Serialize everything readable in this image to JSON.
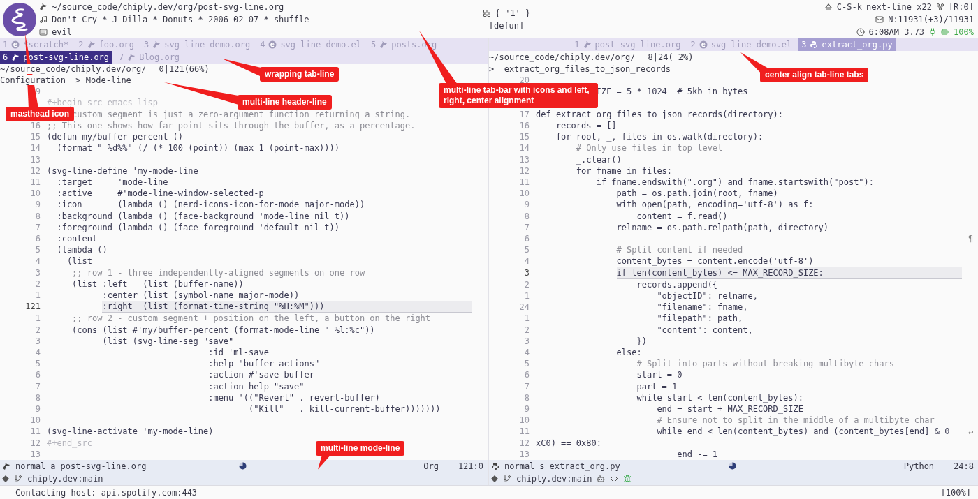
{
  "masthead": {
    "left": [
      {
        "kind": "file",
        "text": "~/source_code/chiply.dev/org/post-svg-line.org"
      },
      {
        "kind": "music",
        "text": "Don't Cry * J Dilla * Donuts * 2006-02-07 * shuffle"
      },
      {
        "kind": "keyboard",
        "text": "evil"
      }
    ],
    "center": [
      {
        "kind": "grid",
        "text": "{ '1' }"
      },
      {
        "kind": "plain",
        "text": "[defun]"
      }
    ],
    "right": [
      [
        {
          "kind": "eject",
          "text": "C-S-k"
        },
        {
          "kind": "plain",
          "text": "next-line x22"
        },
        {
          "kind": "fork",
          "text": "[R:0]"
        }
      ],
      [
        {
          "kind": "mail",
          "text": "N:11931(+3)/11931"
        }
      ],
      [
        {
          "kind": "clock",
          "text": "6:08AM 3.73"
        },
        {
          "kind": "battery",
          "text": "100%"
        }
      ]
    ]
  },
  "panes": [
    {
      "active": true,
      "kind": "wrapping",
      "tab_rows": [
        [
          {
            "number": "1",
            "kind": "elisp",
            "label": "*scratch*",
            "selected": false
          },
          {
            "number": "2",
            "kind": "org",
            "label": "foo.org",
            "selected": false
          },
          {
            "number": "3",
            "kind": "org",
            "label": "svg-line-demo.org",
            "selected": false
          },
          {
            "number": "4",
            "kind": "elisp",
            "label": "svg-line-demo.el",
            "selected": false
          },
          {
            "number": "5",
            "kind": "org",
            "label": "posts.org",
            "selected": false
          }
        ],
        [
          {
            "number": "6",
            "kind": "org",
            "label": "post-svg-line.org",
            "selected": true
          },
          {
            "number": "7",
            "kind": "org",
            "label": "Blog.org",
            "selected": false
          }
        ]
      ],
      "header": [
        {
          "path": "~/source_code/chiply.dev/org/",
          "position": "0|121(66%)"
        },
        {
          "breadcrumb": "Configuration  > Mode-line"
        }
      ],
      "lines": [
        {
          "n": "9"
        },
        {
          "text": "#+begin_src emacs-lisp",
          "kind": "meta"
        },
        {
          "text": "     custom segment is just a zero-argument function returning a string.",
          "kind": "comment"
        },
        {
          "n": "16",
          "text": ";; This one shows how far point sits through the buffer, as a percentage.",
          "kind": "comment"
        },
        {
          "n": "15",
          "text": "(defun my/buffer-percent ()",
          "kind": "code"
        },
        {
          "n": "14",
          "text": "  (format \" %d%%\" (/ (* 100 (point)) (max 1 (point-max))))",
          "kind": "code"
        },
        {
          "n": "13"
        },
        {
          "n": "12",
          "text": "(svg-line-define 'my-mode-line",
          "kind": "code"
        },
        {
          "n": "11",
          "text": "  :target     'mode-line",
          "kind": "code"
        },
        {
          "n": "10",
          "text": "  :active     #'mode-line-window-selected-p",
          "kind": "code"
        },
        {
          "n": "9",
          "text": "  :icon       (lambda () (nerd-icons-icon-for-mode major-mode))",
          "kind": "code"
        },
        {
          "n": "8",
          "text": "  :background (lambda () (face-background 'mode-line nil t))",
          "kind": "code"
        },
        {
          "n": "7",
          "text": "  :foreground (lambda () (face-foreground 'default nil t))",
          "kind": "code"
        },
        {
          "n": "6",
          "text": "  :content",
          "kind": "code"
        },
        {
          "n": "5",
          "text": "  (lambda ()",
          "kind": "code"
        },
        {
          "n": "4",
          "text": "    (list",
          "kind": "code"
        },
        {
          "n": "3",
          "text": "     ;; row 1 - three independently-aligned segments on one row",
          "kind": "comment"
        },
        {
          "n": "2",
          "text": "     (list :left   (list (buffer-name))",
          "kind": "code"
        },
        {
          "n": "1",
          "text": "           :center (list (symbol-name major-mode))",
          "kind": "code"
        },
        {
          "n": "121",
          "text": "           :right  (list (format-time-string \"%H:%M\")))",
          "kind": "code",
          "current": true
        },
        {
          "n": "1",
          "text": "     ;; row 2 - custom segment + position on the left, a button on the right",
          "kind": "comment"
        },
        {
          "n": "2",
          "text": "     (cons (list #'my/buffer-percent (format-mode-line \" %l:%c\"))",
          "kind": "code"
        },
        {
          "n": "3",
          "text": "           (list (svg-line-seg \"save\"",
          "kind": "code"
        },
        {
          "n": "4",
          "text": "                                :id 'ml-save",
          "kind": "code"
        },
        {
          "n": "5",
          "text": "                                :help \"buffer actions\"",
          "kind": "code"
        },
        {
          "n": "6",
          "text": "                                :action #'save-buffer",
          "kind": "code"
        },
        {
          "n": "7",
          "text": "                                :action-help \"save\"",
          "kind": "code"
        },
        {
          "n": "8",
          "text": "                                :menu '((\"Revert\" . revert-buffer)",
          "kind": "code"
        },
        {
          "n": "9",
          "text": "                                        (\"Kill\"   . kill-current-buffer)))))))",
          "kind": "code"
        },
        {
          "n": "10"
        },
        {
          "n": "11",
          "text": "(svg-line-activate 'my-mode-line)",
          "kind": "code"
        },
        {
          "n": "12",
          "text": "#+end_src",
          "kind": "meta"
        },
        {
          "n": "13"
        }
      ],
      "mode_line": {
        "kind": "org",
        "state": "normal",
        "flag": "a",
        "buffer": "post-svg-line.org",
        "mode": "Org",
        "position": "121:0",
        "branch": "chiply.dev:main"
      }
    },
    {
      "active": false,
      "kind": "centered",
      "tab_rows": [
        [
          {
            "number": "1",
            "kind": "org",
            "label": "post-svg-line.org",
            "selected": false
          },
          {
            "number": "2",
            "kind": "elisp",
            "label": "svg-line-demo.el",
            "selected": false
          },
          {
            "number": "3",
            "kind": "python",
            "label": "extract_org.py",
            "selected": true
          }
        ]
      ],
      "header": [
        {
          "path": "~/source_code/chiply.dev/org/",
          "position": "8|24( 2%)"
        },
        {
          "breadcrumb": ">  extract_org_files_to_json_records"
        }
      ],
      "lines": [
        {
          "n": "20"
        },
        {
          "text": "            IZE = 5 * 1024  # 5kb in bytes",
          "kind": "code",
          "blank_after": true
        },
        {
          "n": "17",
          "text": "def extract_org_files_to_json_records(directory):",
          "kind": "code"
        },
        {
          "n": "16",
          "text": "    records = []",
          "kind": "code"
        },
        {
          "n": "15",
          "text": "    for root, _, files in os.walk(directory):",
          "kind": "code"
        },
        {
          "n": "14",
          "text": "        # Only use files in top level",
          "kind": "comment"
        },
        {
          "n": "13",
          "text": "        _.clear()",
          "kind": "code"
        },
        {
          "n": "12",
          "text": "        for fname in files:",
          "kind": "code"
        },
        {
          "n": "11",
          "text": "            if fname.endswith(\".org\") and fname.startswith(\"post\"):",
          "kind": "code"
        },
        {
          "n": "10",
          "text": "                path = os.path.join(root, fname)",
          "kind": "code"
        },
        {
          "n": "9",
          "text": "                with open(path, encoding='utf-8') as f:",
          "kind": "code"
        },
        {
          "n": "8",
          "text": "                    content = f.read()",
          "kind": "code"
        },
        {
          "n": "7",
          "text": "                relname = os.path.relpath(path, directory)",
          "kind": "code"
        },
        {
          "n": "6",
          "fringe": "¶"
        },
        {
          "n": "5",
          "text": "                # Split content if needed",
          "kind": "comment"
        },
        {
          "n": "4",
          "text": "                content_bytes = content.encode('utf-8')",
          "kind": "code"
        },
        {
          "n": "3",
          "text": "                if len(content_bytes) <= MAX_RECORD_SIZE:",
          "kind": "code",
          "current": true
        },
        {
          "n": "2",
          "text": "                    records.append({",
          "kind": "code"
        },
        {
          "n": "1",
          "text": "                        \"objectID\": relname,",
          "kind": "code"
        },
        {
          "n": "24",
          "text": "                        \"filename\": fname,",
          "kind": "code"
        },
        {
          "n": "1",
          "text": "                        \"filepath\": path,",
          "kind": "code"
        },
        {
          "n": "2",
          "text": "                        \"content\": content,",
          "kind": "code"
        },
        {
          "n": "3",
          "text": "                    })",
          "kind": "code"
        },
        {
          "n": "4",
          "text": "                else:",
          "kind": "code"
        },
        {
          "n": "5",
          "text": "                    # Split into parts without breaking multibyte chars",
          "kind": "comment"
        },
        {
          "n": "6",
          "text": "                    start = 0",
          "kind": "code"
        },
        {
          "n": "7",
          "text": "                    part = 1",
          "kind": "code"
        },
        {
          "n": "8",
          "text": "                    while start < len(content_bytes):",
          "kind": "code"
        },
        {
          "n": "9",
          "text": "                        end = start + MAX_RECORD_SIZE",
          "kind": "code"
        },
        {
          "n": "10",
          "text": "                        # Ensure not to split in the middle of a multibyte char",
          "kind": "comment"
        },
        {
          "n": "11",
          "text": "                        while end < len(content_bytes) and (content_bytes[end] & 0",
          "kind": "code",
          "fringe": "↵"
        },
        {
          "n": "12",
          "text": "xC0) == 0x80:",
          "kind": "code"
        },
        {
          "n": "13",
          "text": "                            end -= 1",
          "kind": "code"
        }
      ],
      "mode_line": {
        "kind": "python",
        "state": "normal",
        "flag": "s",
        "buffer": "extract_org.py",
        "mode": "Python",
        "position": "24:8",
        "branch": "chiply.dev:main"
      }
    }
  ],
  "echo_area": {
    "message": "Contacting host: api.spotify.com:443",
    "progress": "[100%]"
  },
  "callouts": [
    {
      "text": "masthead icon"
    },
    {
      "text": "wrapping tab-line"
    },
    {
      "text": "multi-line header-line"
    },
    {
      "text": "multi-line tab-bar with icons and left, right, center alignment"
    },
    {
      "text": "center align tab-line tabs"
    },
    {
      "text": "multi-line mode-line"
    }
  ]
}
